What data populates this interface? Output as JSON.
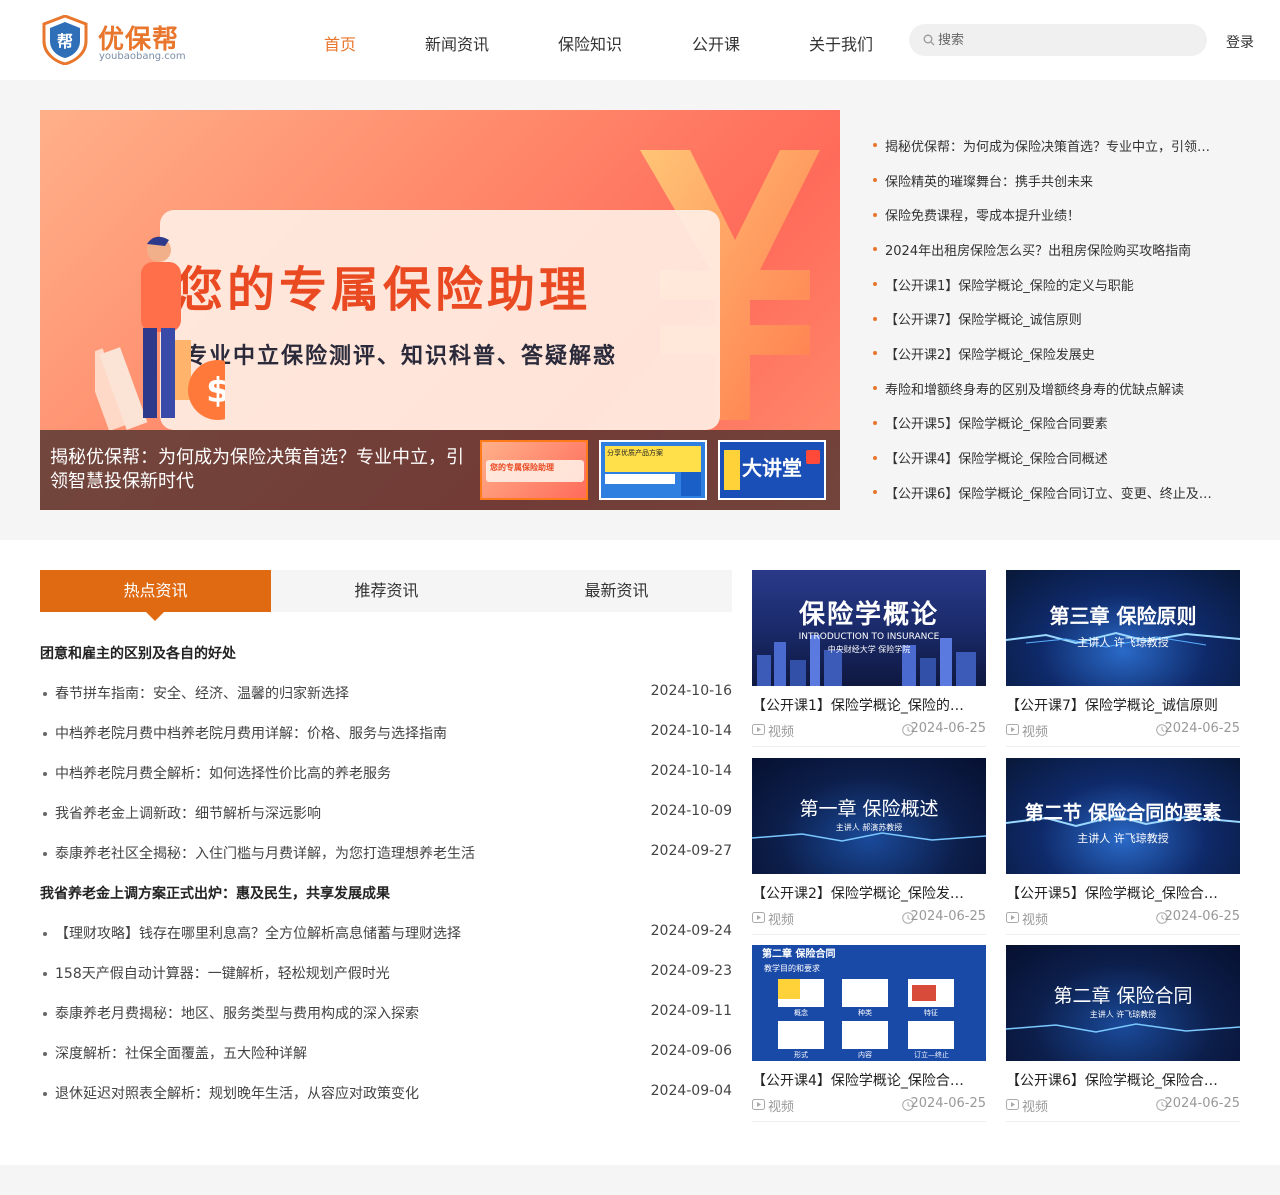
{
  "header": {
    "logo_text": "优保帮",
    "logo_sub": "youbaobang.com",
    "logo_badge": "帮",
    "nav": [
      {
        "label": "首页",
        "active": true
      },
      {
        "label": "新闻资讯",
        "active": false
      },
      {
        "label": "保险知识",
        "active": false
      },
      {
        "label": "公开课",
        "active": false
      },
      {
        "label": "关于我们",
        "active": false
      }
    ],
    "search_placeholder": "搜索",
    "login": "登录"
  },
  "banner": {
    "title": "您的专属保险助理",
    "subtitle": "专业中立保险测评、知识科普、答疑解惑",
    "caption": "揭秘优保帮：为何成为保险决策首选？专业中立，引领智慧投保新时代",
    "thumbs": [
      {
        "text": "您的专属保险助理",
        "active": true
      },
      {
        "text": "分享优质产品方案",
        "active": false
      },
      {
        "text": "大讲堂",
        "active": false
      }
    ]
  },
  "side_news": [
    "揭秘优保帮：为何成为保险决策首选？专业中立，引领…",
    "保险精英的璀璨舞台：携手共创未来",
    "保险免费课程，零成本提升业绩！",
    "2024年出租房保险怎么买？出租房保险购买攻略指南",
    "【公开课1】保险学概论_保险的定义与职能",
    "【公开课7】保险学概论_诚信原则",
    "【公开课2】保险学概论_保险发展史",
    "寿险和增额终身寿的区别及增额终身寿的优缺点解读",
    "【公开课5】保险学概论_保险合同要素",
    "【公开课4】保险学概论_保险合同概述",
    "【公开课6】保险学概论_保险合同订立、变更、终止及…"
  ],
  "tabs": [
    "热点资讯",
    "推荐资讯",
    "最新资讯"
  ],
  "articles": {
    "group1": {
      "heading": "团意和雇主的区别及各自的好处",
      "items": [
        {
          "title": "春节拼车指南：安全、经济、温馨的归家新选择",
          "date": "2024-10-16"
        },
        {
          "title": "中档养老院月费中档养老院月费用详解：价格、服务与选择指南",
          "date": "2024-10-14"
        },
        {
          "title": "中档养老院月费全解析：如何选择性价比高的养老服务",
          "date": "2024-10-14"
        },
        {
          "title": "我省养老金上调新政：细节解析与深远影响",
          "date": "2024-10-09"
        },
        {
          "title": "泰康养老社区全揭秘：入住门槛与月费详解，为您打造理想养老生活",
          "date": "2024-09-27"
        }
      ]
    },
    "group2": {
      "heading": "我省养老金上调方案正式出炉：惠及民生，共享发展成果",
      "items": [
        {
          "title": "【理财攻略】钱存在哪里利息高？全方位解析高息储蓄与理财选择",
          "date": "2024-09-24"
        },
        {
          "title": "158天产假自动计算器：一键解析，轻松规划产假时光",
          "date": "2024-09-23"
        },
        {
          "title": "泰康养老月费揭秘：地区、服务类型与费用构成的深入探索",
          "date": "2024-09-11"
        },
        {
          "title": "深度解析：社保全面覆盖，五大险种详解",
          "date": "2024-09-06"
        },
        {
          "title": "退休延迟对照表全解析：规划晚年生活，从容应对政策变化",
          "date": "2024-09-04"
        }
      ]
    }
  },
  "videos": [
    {
      "title": "【公开课1】保险学概论_保险的…",
      "type": "视频",
      "date": "2024-06-25",
      "cover_title": "保险学概论",
      "cover_sub": "INTRODUCTION TO INSURANCE",
      "cover_sub2": "中央财经大学 保险学院"
    },
    {
      "title": "【公开课7】保险学概论_诚信原则",
      "type": "视频",
      "date": "2024-06-25",
      "cover_title": "第三章 保险原则",
      "cover_sub": "主讲人 许飞琼教授"
    },
    {
      "title": "【公开课2】保险学概论_保险发…",
      "type": "视频",
      "date": "2024-06-25",
      "cover_title": "第一章 保险概述",
      "cover_sub": "主讲人 郝演苏教授"
    },
    {
      "title": "【公开课5】保险学概论_保险合…",
      "type": "视频",
      "date": "2024-06-25",
      "cover_title": "第二节 保险合同的要素",
      "cover_sub": "主讲人 许飞琼教授"
    },
    {
      "title": "【公开课4】保险学概论_保险合…",
      "type": "视频",
      "date": "2024-06-25",
      "cover_title": "第二章 保险合同",
      "cover_sub": "教学目的和要求",
      "cover_labels": [
        "概念",
        "种类",
        "特征",
        "形式",
        "内容",
        "订立—终止"
      ]
    },
    {
      "title": "【公开课6】保险学概论_保险合…",
      "type": "视频",
      "date": "2024-06-25",
      "cover_title": "第二章 保险合同",
      "cover_sub": "主讲人 许飞琼教授"
    }
  ],
  "colors": {
    "accent": "#e8762c",
    "tab_active": "#e06a12"
  }
}
